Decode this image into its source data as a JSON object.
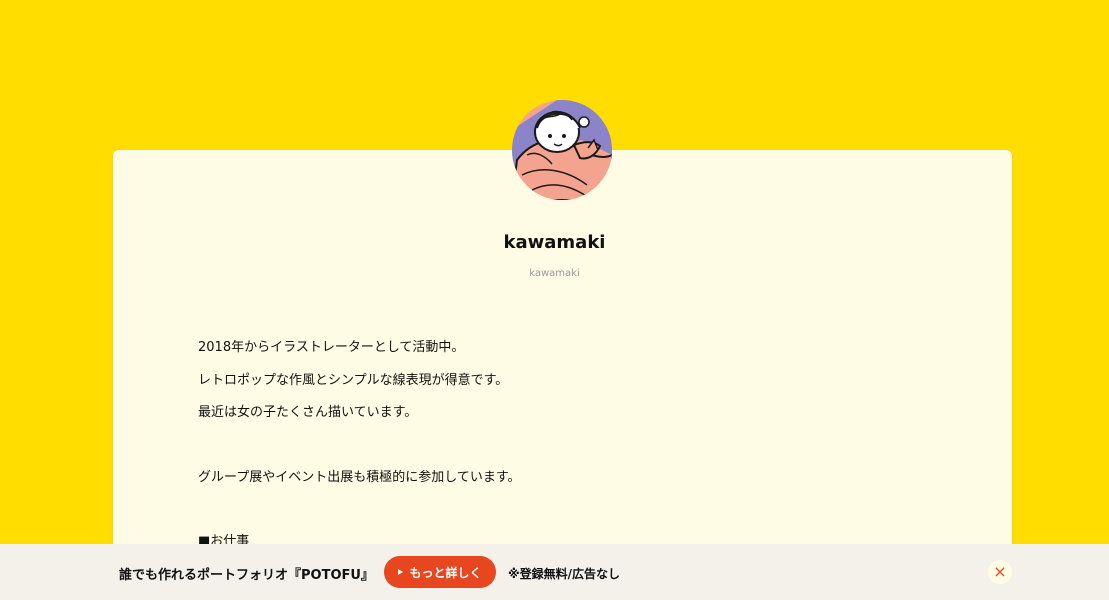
{
  "profile": {
    "display_name": "kawamaki",
    "user_id": "kawamaki"
  },
  "bio": {
    "lines": [
      "2018年からイラストレーターとして活動中。",
      "レトロポップな作風とシンプルな線表現が得意です。",
      "最近は女の子たくさん描いています。",
      "グループ展やイベント出展も積極的に参加しています。",
      "■お仕事"
    ]
  },
  "banner": {
    "text": "誰でも作れるポートフォリオ『POTOFU』",
    "button_label": "もっと詳しく",
    "note": "※登録無料/広告なし",
    "close_label": "×",
    "play_icon": "play-icon",
    "close_icon": "close-icon"
  },
  "colors": {
    "background": "#FFDD00",
    "card": "#FFFCE6",
    "banner_background": "#F4F1EA",
    "accent": "#E8461E"
  }
}
